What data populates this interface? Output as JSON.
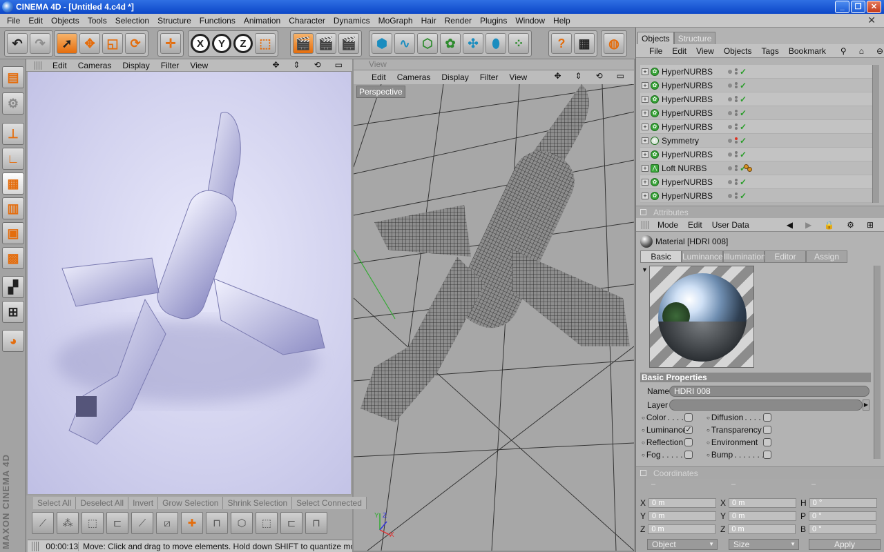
{
  "window": {
    "title": "CINEMA 4D - [Untitled 4.c4d *]"
  },
  "menubar": [
    "File",
    "Edit",
    "Objects",
    "Tools",
    "Selection",
    "Structure",
    "Functions",
    "Animation",
    "Character",
    "Dynamics",
    "MoGraph",
    "Hair",
    "Render",
    "Plugins",
    "Window",
    "Help"
  ],
  "viewport_left": {
    "menu": [
      "Edit",
      "Cameras",
      "Display",
      "Filter",
      "View"
    ]
  },
  "viewport_right": {
    "title": "View",
    "menu": [
      "Edit",
      "Cameras",
      "Display",
      "Filter",
      "View"
    ],
    "camera_label": "Perspective"
  },
  "selection_bar": [
    "Select All",
    "Deselect All",
    "Invert",
    "Grow Selection",
    "Shrink Selection",
    "Select Connected"
  ],
  "statusbar": {
    "time": "00:00:13",
    "message": "Move: Click and drag to move elements. Hold down SHIFT to quantize movement /"
  },
  "brand": {
    "line1": "MAXON",
    "line2": "CINEMA 4D"
  },
  "objects_panel": {
    "tabs": [
      "Objects",
      "Structure"
    ],
    "menu": [
      "File",
      "Edit",
      "View",
      "Objects",
      "Tags",
      "Bookmark"
    ],
    "items": [
      {
        "name": "HyperNURBS"
      },
      {
        "name": "HyperNURBS"
      },
      {
        "name": "HyperNURBS"
      },
      {
        "name": "HyperNURBS"
      },
      {
        "name": "HyperNURBS"
      },
      {
        "name": "Symmetry"
      },
      {
        "name": "HyperNURBS"
      },
      {
        "name": "Loft NURBS"
      },
      {
        "name": "HyperNURBS"
      },
      {
        "name": "HyperNURBS"
      }
    ]
  },
  "attributes_panel": {
    "section": "Attributes",
    "menu": [
      "Mode",
      "Edit",
      "User Data"
    ],
    "material_title": "Material [HDRI 008]",
    "tabs": [
      "Basic",
      "Luminance",
      "Illumination",
      "Editor",
      "Assign"
    ],
    "basic_properties_header": "Basic Properties",
    "name_label": "Name",
    "name_value": "HDRI 008",
    "layer_label": "Layer",
    "channels_left": [
      {
        "label": "Color",
        "dots": ". . . . .",
        "checked": false
      },
      {
        "label": "Luminance",
        "dots": "",
        "checked": true
      },
      {
        "label": "Reflection",
        "dots": "",
        "checked": false
      },
      {
        "label": "Fog",
        "dots": ". . . . . .",
        "checked": false
      }
    ],
    "channels_right": [
      {
        "label": "Diffusion",
        "dots": ". . . . .",
        "checked": false
      },
      {
        "label": "Transparency",
        "dots": "",
        "checked": false
      },
      {
        "label": "Environment",
        "dots": "",
        "checked": false
      },
      {
        "label": "Bump",
        "dots": ". . . . . . .",
        "checked": false
      }
    ]
  },
  "coordinates_panel": {
    "section": "Coordinates",
    "rows": [
      {
        "a": "X",
        "av": "0 m",
        "b": "X",
        "bv": "0 m",
        "c": "H",
        "cv": "0 °"
      },
      {
        "a": "Y",
        "av": "0 m",
        "b": "Y",
        "bv": "0 m",
        "c": "P",
        "cv": "0 °"
      },
      {
        "a": "Z",
        "av": "0 m",
        "b": "Z",
        "bv": "0 m",
        "c": "B",
        "cv": "0 °"
      }
    ],
    "mode_dropdown": "Object",
    "size_dropdown": "Size",
    "apply_label": "Apply"
  },
  "icons": {
    "toolbar": [
      "undo-icon",
      "redo-icon",
      "live-select-icon",
      "move-icon",
      "scale-icon",
      "rotate-icon",
      "world-axis-icon",
      "x-axis-lock-icon",
      "y-axis-lock-icon",
      "z-axis-lock-icon",
      "coordinate-system-icon",
      "render-view-icon",
      "render-picture-viewer-icon",
      "render-settings-icon",
      "cube-icon",
      "spline-icon",
      "nurbs-icon",
      "array-icon",
      "deformer-icon",
      "scene-icon",
      "particle-icon",
      "help-icon",
      "timeline-icon",
      "web-icon"
    ]
  },
  "colors": {
    "accent": "#e46d0d",
    "titlebar": "#0c47c8",
    "check": "#2a9d2a"
  }
}
